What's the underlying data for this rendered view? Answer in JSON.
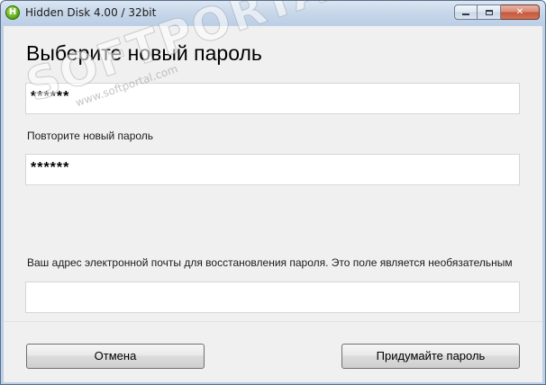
{
  "window": {
    "title": "Hidden Disk 4.00 / 32bit",
    "app_icon_letter": "H"
  },
  "main": {
    "heading": "Выберите новый пароль",
    "password_value": "******",
    "repeat_label": "Повторите новый пароль",
    "repeat_value": "******",
    "email_label": "Ваш адрес электронной почты для восстановления пароля. Это поле является необязательным",
    "email_value": ""
  },
  "buttons": {
    "cancel": "Отмена",
    "create": "Придумайте пароль"
  },
  "watermark": {
    "brand": "SOFTPORTAL",
    "url": "www.softportal.com"
  },
  "colors": {
    "titlebar": "#bccfe6",
    "client_bg": "#f0f0f0",
    "close_button": "#c5573a"
  }
}
